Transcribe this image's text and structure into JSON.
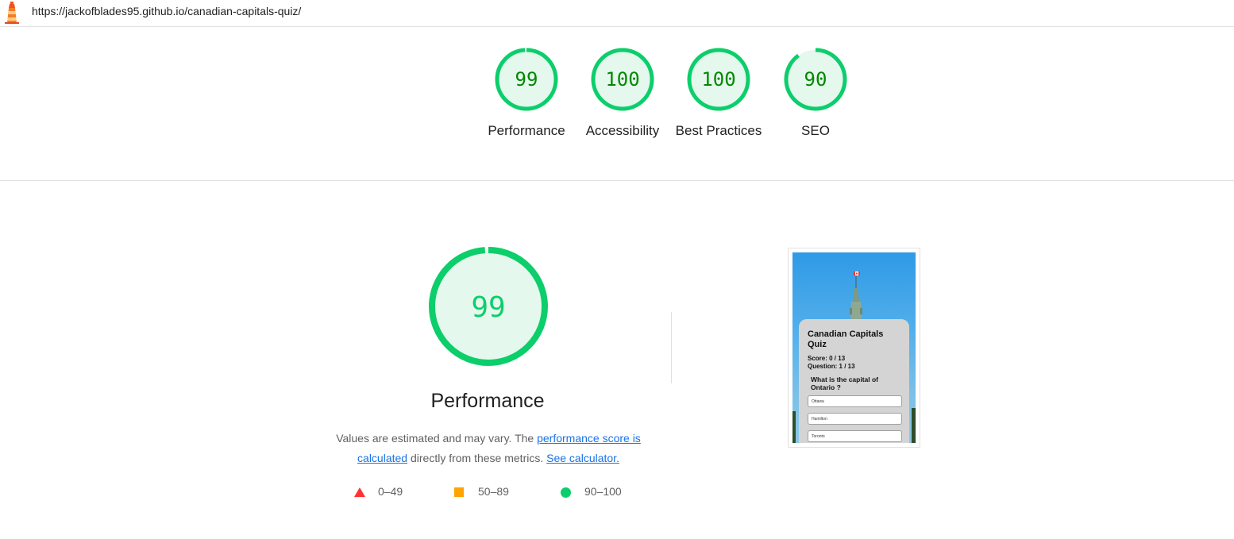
{
  "url": "https://jackofblades95.github.io/canadian-capitals-quiz/",
  "colors": {
    "pass": "#0cce6b",
    "pass_text": "#008800",
    "pass_bg": "#e5f8ed",
    "average": "#ffa400",
    "fail": "#ff3333"
  },
  "gauges": [
    {
      "score": "99",
      "label": "Performance",
      "value": 99
    },
    {
      "score": "100",
      "label": "Accessibility",
      "value": 100
    },
    {
      "score": "100",
      "label": "Best Practices",
      "value": 100
    },
    {
      "score": "90",
      "label": "SEO",
      "value": 90
    }
  ],
  "performance": {
    "score": "99",
    "value": 99,
    "title": "Performance",
    "desc_before": "Values are estimated and may vary. The ",
    "desc_link1": "performance score is calculated",
    "desc_middle": " directly from these metrics. ",
    "desc_link2": "See calculator."
  },
  "scale": [
    {
      "shape": "triangle-icon",
      "range": "0–49"
    },
    {
      "shape": "square-icon",
      "range": "50–89"
    },
    {
      "shape": "circle-icon",
      "range": "90–100"
    }
  ],
  "screenshot": {
    "title": "Canadian Capitals Quiz",
    "score": "Score: 0 / 13",
    "question_count": "Question: 1 / 13",
    "question": "What is the capital of Ontario ?",
    "options": [
      "Ottawa",
      "Hamilton",
      "Toronto"
    ]
  }
}
